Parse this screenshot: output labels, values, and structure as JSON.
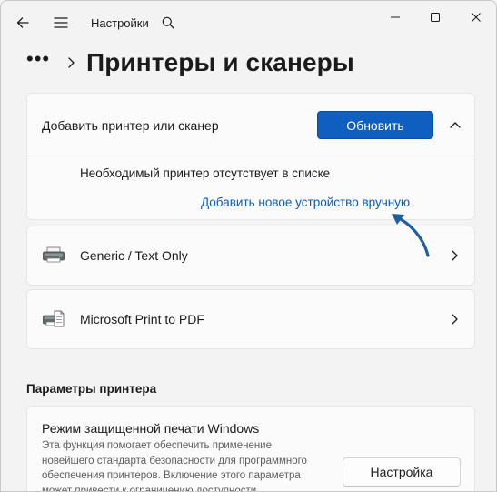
{
  "titlebar": {
    "app_title": "Настройки",
    "icons": {
      "back": "back-arrow-icon",
      "menu": "hamburger-menu-icon",
      "search": "search-icon",
      "minimize": "minimize-icon",
      "maximize": "maximize-icon",
      "close": "close-icon"
    }
  },
  "breadcrumb": {
    "more": "•••",
    "page_title": "Принтеры и сканеры"
  },
  "add_printer": {
    "label": "Добавить принтер или сканер",
    "refresh_button": "Обновить",
    "missing_text": "Необходимый принтер отсутствует в списке",
    "manual_link": "Добавить новое устройство вручную"
  },
  "printers": [
    {
      "name": "Generic / Text Only",
      "icon": "printer-icon"
    },
    {
      "name": "Microsoft Print to PDF",
      "icon": "pdf-printer-icon"
    }
  ],
  "printer_settings": {
    "section_title": "Параметры принтера",
    "protected_mode": {
      "title": "Режим защищенной печати Windows",
      "description": "Эта функция помогает обеспечить применение новейшего стандарта безопасности для программного обеспечения принтеров. Включение этого параметра может привести к ограничению доступности",
      "button": "Настройка"
    }
  },
  "colors": {
    "accent": "#0f5fc0",
    "link": "#0a5bb5",
    "annotation_arrow": "#1f5f9e",
    "background": "#f3f3f3",
    "card": "#fbfbfb"
  }
}
